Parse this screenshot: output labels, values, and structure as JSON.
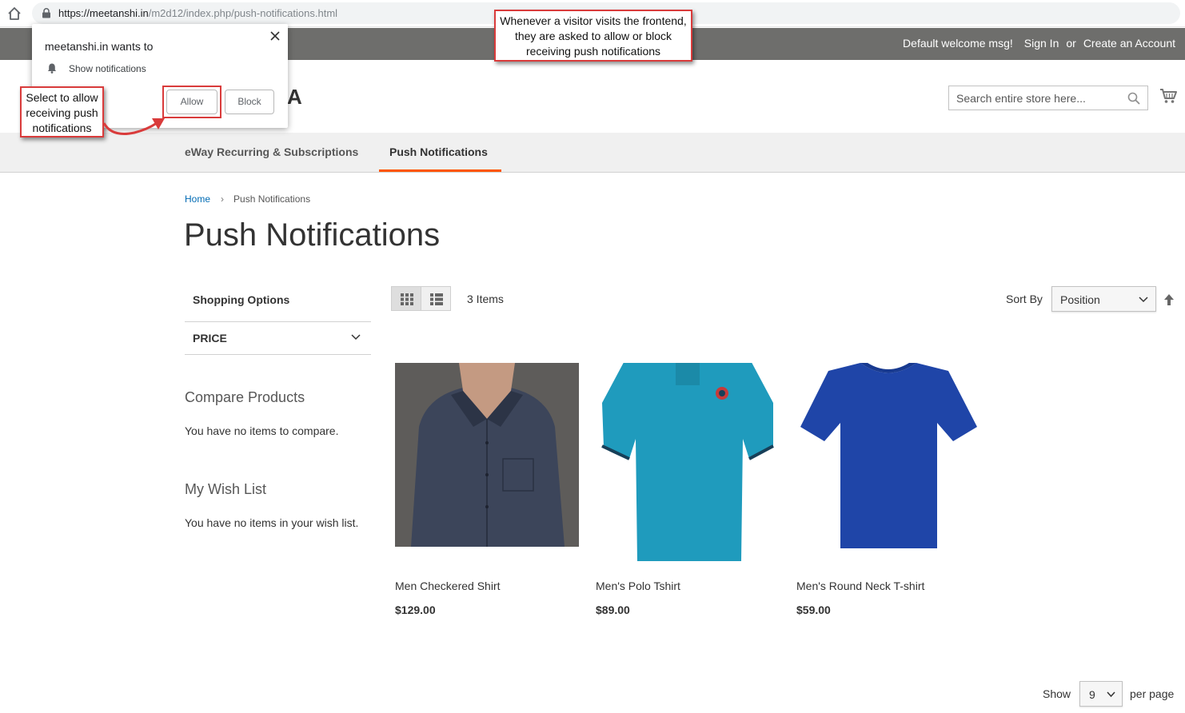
{
  "browser": {
    "url_host": "https://meetanshi.in",
    "url_path": "/m2d12/index.php/push-notifications.html"
  },
  "top_panel": {
    "welcome": "Default welcome msg!",
    "sign_in": "Sign In",
    "or": "or",
    "create_account": "Create an Account"
  },
  "header": {
    "logo_fragment": "A",
    "search_placeholder": "Search entire store here..."
  },
  "nav": {
    "items": [
      {
        "label": "eWay Recurring & Subscriptions"
      },
      {
        "label": "Push Notifications"
      }
    ]
  },
  "breadcrumb": {
    "home": "Home",
    "separator": "›",
    "current": "Push Notifications"
  },
  "page_title": "Push Notifications",
  "sidebar": {
    "shopping_options": "Shopping Options",
    "price_filter": "PRICE",
    "compare_title": "Compare Products",
    "compare_text": "You have no items to compare.",
    "wishlist_title": "My Wish List",
    "wishlist_text": "You have no items in your wish list."
  },
  "toolbar": {
    "items_count": "3 Items",
    "sort_label": "Sort By",
    "sort_value": "Position",
    "show_label": "Show",
    "limit_value": "9",
    "per_page_label": "per page"
  },
  "products": [
    {
      "name": "Men Checkered Shirt",
      "price": "$129.00"
    },
    {
      "name": "Men's Polo Tshirt",
      "price": "$89.00"
    },
    {
      "name": "Men's Round Neck T-shirt",
      "price": "$59.00"
    }
  ],
  "permission_popup": {
    "title": "meetanshi.in wants to",
    "description": "Show notifications",
    "allow": "Allow",
    "block": "Block"
  },
  "annotations": {
    "top": "Whenever a visitor visits the frontend, they are asked to allow or block receiving push notifications",
    "left": "Select to allow receiving push notifications"
  },
  "colors": {
    "accent": "#ff5501",
    "annotation_red": "#d93b3b",
    "link": "#006bb4",
    "top_panel_bg": "#6e6e6c",
    "polo_teal": "#1f9bbd",
    "round_neck_blue": "#1f45a8",
    "shirt_navy": "#3c455a"
  }
}
